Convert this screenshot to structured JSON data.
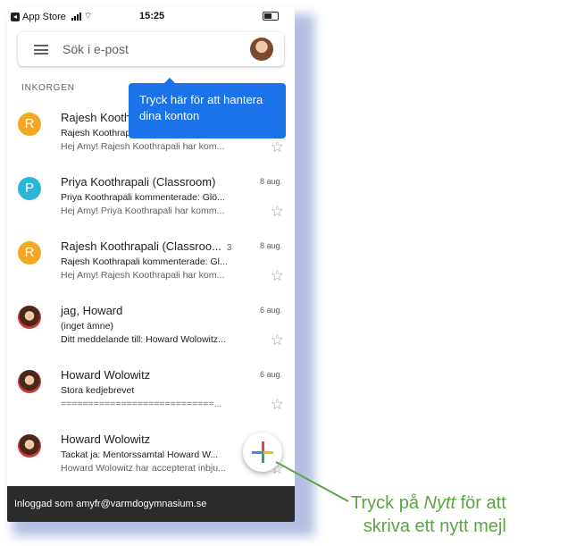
{
  "status_bar": {
    "carrier": "App Store",
    "time": "15:25"
  },
  "search": {
    "placeholder": "Sök i e-post"
  },
  "section_label": "INKORGEN",
  "tooltip": {
    "text": "Tryck här för att hantera dina konton"
  },
  "emails": [
    {
      "avatar_letter": "R",
      "avatar_color": "#f5a623",
      "sender": "Rajesh Koothrapali",
      "count": "",
      "date": "",
      "subject": "Rajesh Koothrapali",
      "snippet": "Hej Amy! Rajesh Koothrapali har kom..."
    },
    {
      "avatar_letter": "P",
      "avatar_color": "#2bb5d8",
      "sender": "Priya Koothrapali (Classroom)",
      "count": "",
      "date": "8 aug.",
      "subject": "Priya Koothrapali kommenterade: Glö...",
      "snippet": "Hej Amy! Priya Koothrapali har komm..."
    },
    {
      "avatar_letter": "R",
      "avatar_color": "#f5a623",
      "sender": "Rajesh Koothrapali (Classroo...",
      "count": "3",
      "date": "8 aug.",
      "subject": "Rajesh Koothrapali kommenterade: Gl...",
      "snippet": "Hej Amy! Rajesh Koothrapali har kom..."
    },
    {
      "avatar_letter": "",
      "avatar_color": "",
      "sender": "jag, Howard",
      "count": "",
      "date": "6 aug.",
      "subject": "(inget ämne)",
      "snippet": "Ditt meddelande till: Howard Wolowitz..."
    },
    {
      "avatar_letter": "",
      "avatar_color": "",
      "sender": "Howard Wolowitz",
      "count": "",
      "date": "6 aug.",
      "subject": "Stora kedjebrevet",
      "snippet": "============================..."
    },
    {
      "avatar_letter": "",
      "avatar_color": "",
      "sender": "Howard Wolowitz",
      "count": "",
      "date": "",
      "subject": "Tackat ja: Mentorssamtal Howard W...",
      "snippet": "Howard Wolowitz har accepterat inbju..."
    }
  ],
  "fab": {
    "icon": "plus-icon",
    "colors": [
      "#ea4335",
      "#fbbc04",
      "#34a853",
      "#4285f4"
    ]
  },
  "bottom_bar": {
    "text": "Inloggad som amyfr@varmdogymnasium.se"
  },
  "annotation": {
    "prefix": "Tryck på ",
    "emphasis": "Nytt",
    "suffix": " för att",
    "line2": "skriva ett nytt mejl",
    "color": "#5aa446"
  }
}
